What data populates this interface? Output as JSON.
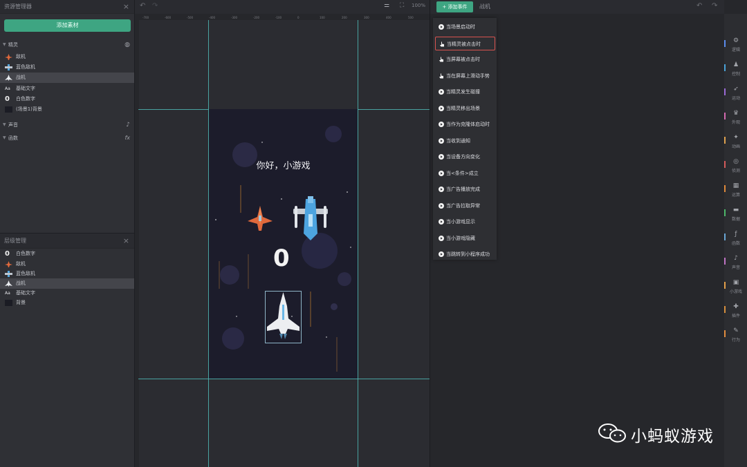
{
  "assets_panel": {
    "title": "资源管理器",
    "add_button": "添加素材",
    "sprites_section": "精灵",
    "sprites": [
      "敌机",
      "蓝色敌机",
      "战机",
      "基础文字",
      "白色数字",
      "(场景1)背景"
    ],
    "sound_section": "声音",
    "function_section": "函数",
    "function_icon_text": "fx",
    "selected_sprite": "战机"
  },
  "layers_panel": {
    "title": "层级管理",
    "layers": [
      "白色数字",
      "敌机",
      "蓝色敌机",
      "战机",
      "基础文字",
      "背景"
    ],
    "selected_layer": "战机"
  },
  "canvas": {
    "zoom": "100%",
    "ruler_labels": [
      "-700",
      "-600",
      "-500",
      "-400",
      "-300",
      "-200",
      "-100",
      "0",
      "100",
      "200",
      "300",
      "400",
      "500"
    ],
    "stage_text": "你好，小游戏",
    "score": "0"
  },
  "events": {
    "add_button": "添加事件",
    "target": "战机",
    "items": [
      {
        "label": "当场景启动时",
        "icon": "play-icon"
      },
      {
        "label": "当精灵被点击时",
        "icon": "hand-icon",
        "highlighted": true
      },
      {
        "label": "当屏幕被点击时",
        "icon": "hand-icon"
      },
      {
        "label": "当在屏幕上滑动手势",
        "icon": "hand-icon"
      },
      {
        "label": "当精灵发生碰撞",
        "icon": "play-icon"
      },
      {
        "label": "当精灵移出场景",
        "icon": "play-icon"
      },
      {
        "label": "当作为克隆体启动时",
        "icon": "play-icon"
      },
      {
        "label": "当收到通知",
        "icon": "play-icon"
      },
      {
        "label": "当设备方向变化",
        "icon": "play-icon"
      },
      {
        "label": "当<条件>成立",
        "icon": "play-icon"
      },
      {
        "label": "当广告播放完成",
        "icon": "play-icon"
      },
      {
        "label": "当广告拉取异常",
        "icon": "play-icon"
      },
      {
        "label": "当小游戏显示",
        "icon": "play-icon"
      },
      {
        "label": "当小游戏隐藏",
        "icon": "play-icon"
      },
      {
        "label": "当跳转到小程序成功",
        "icon": "play-icon"
      }
    ]
  },
  "categories": [
    {
      "label": "逻辑",
      "color": "#5b8def",
      "icon": "logic-icon"
    },
    {
      "label": "控制",
      "color": "#4aa3d9",
      "icon": "control-icon"
    },
    {
      "label": "运动",
      "color": "#9b6ad6",
      "icon": "motion-icon"
    },
    {
      "label": "外观",
      "color": "#d46ab0",
      "icon": "looks-icon"
    },
    {
      "label": "动画",
      "color": "#e0a24f",
      "icon": "animation-icon"
    },
    {
      "label": "侦测",
      "color": "#d45b5b",
      "icon": "sensing-icon"
    },
    {
      "label": "运算",
      "color": "#e08a3a",
      "icon": "operator-icon"
    },
    {
      "label": "数据",
      "color": "#4db86a",
      "icon": "data-icon"
    },
    {
      "label": "函数",
      "color": "#6aa7d6",
      "icon": "function-icon"
    },
    {
      "label": "声音",
      "color": "#c074c4",
      "icon": "sound-icon"
    },
    {
      "label": "小游戏",
      "color": "#e4a04a",
      "icon": "minigame-icon"
    },
    {
      "label": "插件",
      "color": "#d8903e",
      "icon": "plugin-icon"
    },
    {
      "label": "行为",
      "color": "#e28d3f",
      "icon": "behavior-icon"
    }
  ],
  "watermark": "小蚂蚁游戏"
}
